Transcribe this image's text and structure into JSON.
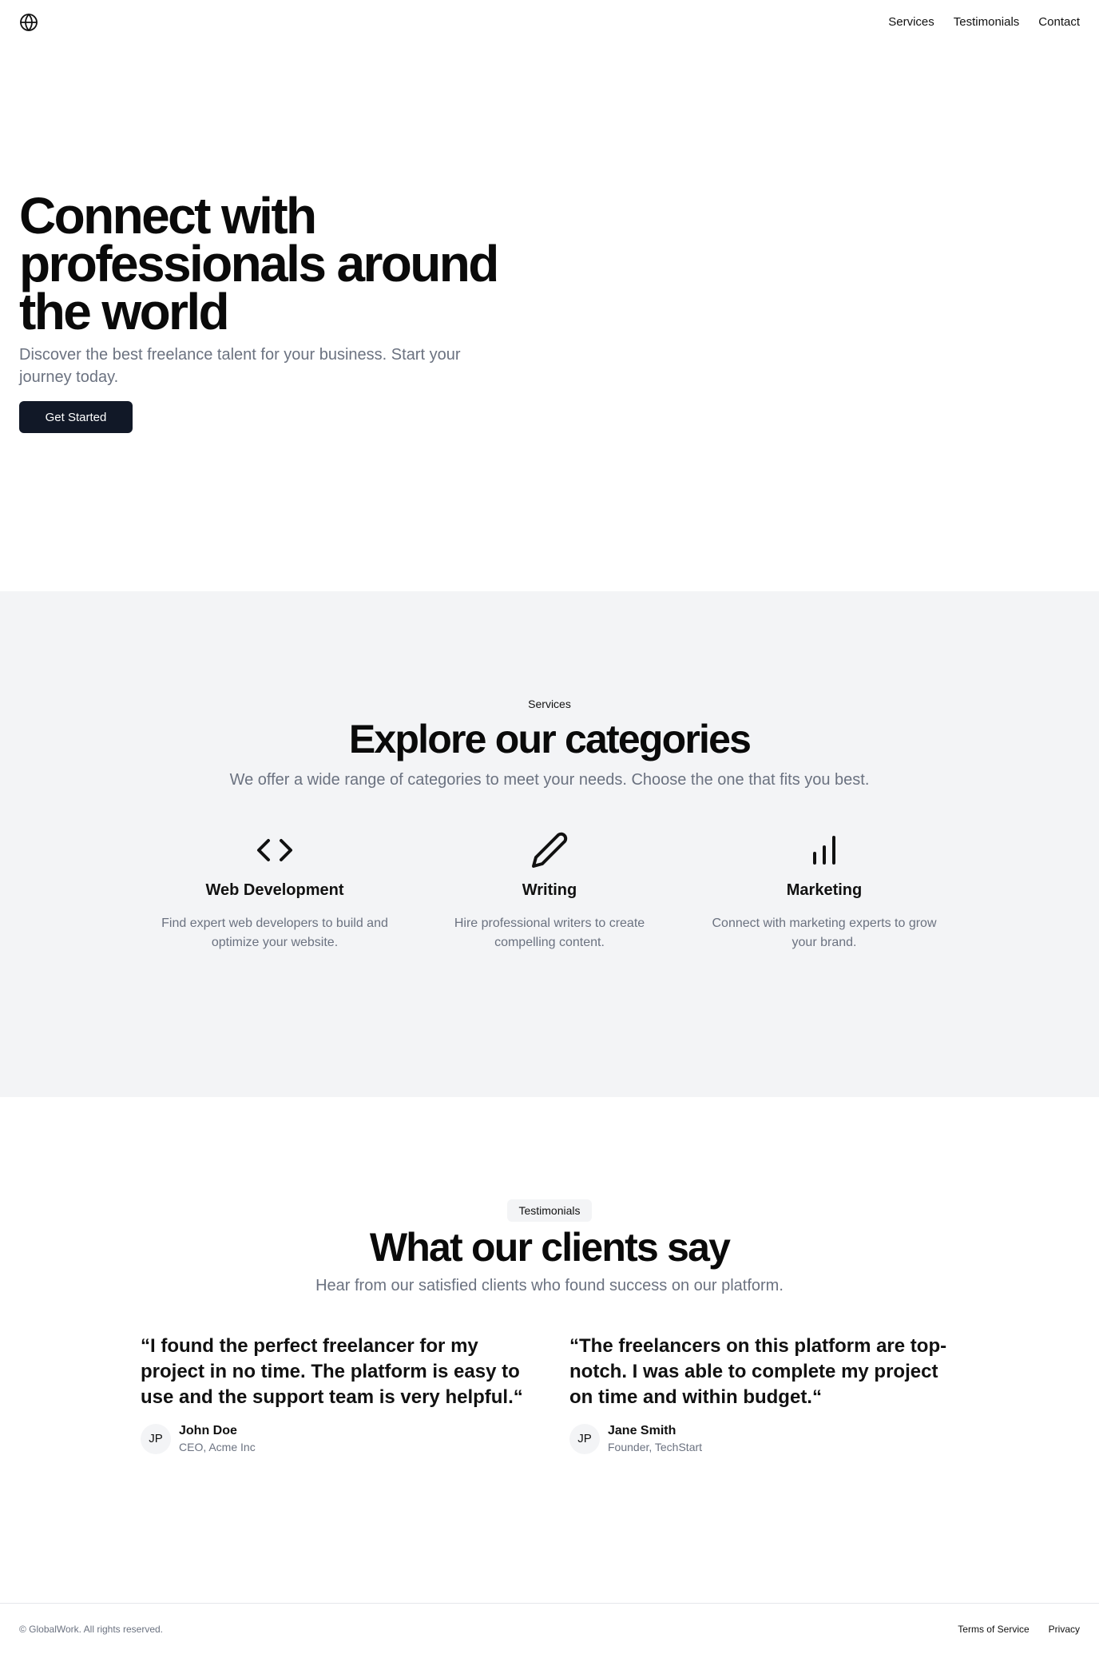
{
  "header": {
    "logo_icon": "globe-icon",
    "nav": [
      {
        "label": "Services"
      },
      {
        "label": "Testimonials"
      },
      {
        "label": "Contact"
      }
    ]
  },
  "hero": {
    "title": "Connect with professionals around the world",
    "subtitle": "Discover the best freelance talent for your business. Start your journey today.",
    "cta_label": "Get Started"
  },
  "services": {
    "eyebrow": "Services",
    "title": "Explore our categories",
    "subtitle": "We offer a wide range of categories to meet your needs. Choose the one that fits you best.",
    "categories": [
      {
        "icon": "code-icon",
        "title": "Web Development",
        "description": "Find expert web developers to build and optimize your website."
      },
      {
        "icon": "pencil-icon",
        "title": "Writing",
        "description": "Hire professional writers to create compelling content."
      },
      {
        "icon": "bar-chart-icon",
        "title": "Marketing",
        "description": "Connect with marketing experts to grow your brand."
      }
    ]
  },
  "testimonials": {
    "badge": "Testimonials",
    "title": "What our clients say",
    "subtitle": "Hear from our satisfied clients who found success on our platform.",
    "items": [
      {
        "quote": "“I found the perfect freelancer for my project in no time. The platform is easy to use and the support team is very helpful.“",
        "initials": "JP",
        "name": "John Doe",
        "role": "CEO, Acme Inc"
      },
      {
        "quote": "“The freelancers on this platform are top-notch. I was able to complete my project on time and within budget.“",
        "initials": "JP",
        "name": "Jane Smith",
        "role": "Founder, TechStart"
      }
    ]
  },
  "footer": {
    "copyright": "© GlobalWork. All rights reserved.",
    "links": [
      {
        "label": "Terms of Service"
      },
      {
        "label": "Privacy"
      }
    ]
  },
  "colors": {
    "primary_button": "#111827",
    "muted_text": "#6b7280",
    "section_bg": "#f3f4f6"
  }
}
